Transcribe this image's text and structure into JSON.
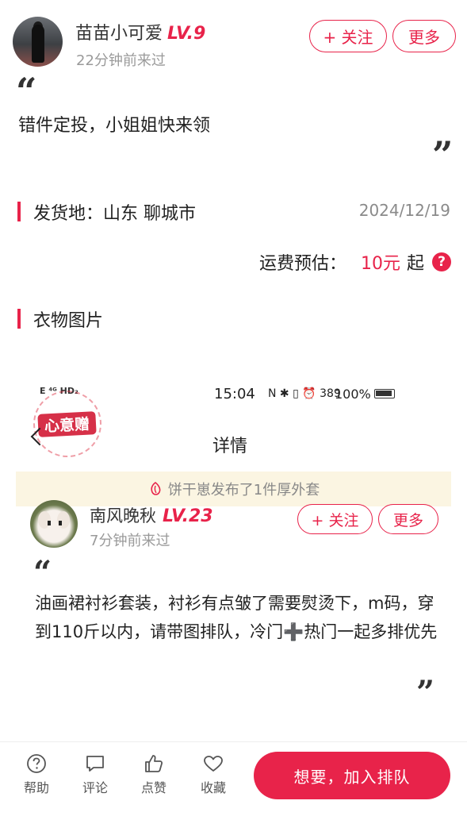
{
  "header": {
    "username": "苗苗小可爱",
    "level": "LV.9",
    "last_seen": "22分钟前来过",
    "follow_label": "+ 关注",
    "more_label": "更多"
  },
  "post": {
    "quote_open": "“",
    "quote_close": "”",
    "description": "错件定投，小姐姐快来领"
  },
  "shipping": {
    "origin": "发货地：山东 聊城市",
    "date": "2024/12/19",
    "fee_label": "运费预估：",
    "fee_amount": "10元",
    "fee_suffix": "起",
    "help_icon": "?"
  },
  "images_section": {
    "title": "衣物图片"
  },
  "embedded_screenshot": {
    "status_bar": {
      "signal": "E ⁴ᴳ HD₂",
      "time": "15:04",
      "icons": "N ✱ ▯ ⏰ 389",
      "battery": "100%"
    },
    "stamp_label": "心意赠",
    "page_title": "详情",
    "notice": "饼干崽发布了1件厚外套",
    "user": {
      "username": "南风晚秋",
      "level": "LV.23",
      "last_seen": "7分钟前来过",
      "follow_label": "+ 关注",
      "more_label": "更多"
    },
    "description": "油画裙衬衫套装，衬衫有点皱了需要熨烫下，m码，穿到110斤以内，请带图排队，冷门➕热门一起多排优先"
  },
  "bottom_nav": {
    "items": [
      {
        "label": "帮助",
        "icon": "help-icon"
      },
      {
        "label": "评论",
        "icon": "comment-icon"
      },
      {
        "label": "点赞",
        "icon": "thumbs-up-icon"
      },
      {
        "label": "收藏",
        "icon": "heart-icon"
      }
    ],
    "cta_label": "想要，加入排队"
  },
  "colors": {
    "accent": "#e8234a",
    "muted_text": "#9a9a9a",
    "notice_bg": "#fbf5e2"
  }
}
